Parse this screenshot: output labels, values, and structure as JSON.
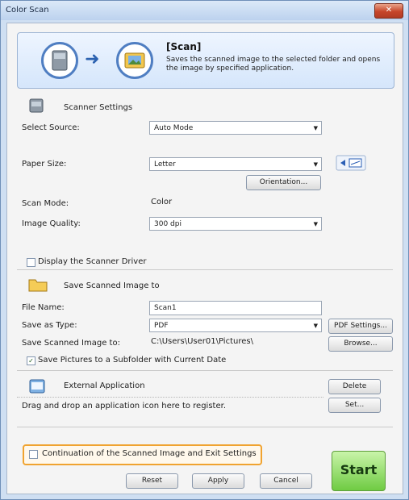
{
  "window": {
    "title": "Color Scan"
  },
  "header": {
    "title": "[Scan]",
    "description": "Saves the scanned image to the selected folder and opens the image by specified application.",
    "icons": [
      "scanner-icon",
      "arrow-right-icon",
      "picture-folder-icon"
    ]
  },
  "scanner_settings": {
    "section_label": "Scanner Settings",
    "select_source_label": "Select Source:",
    "select_source_value": "Auto Mode",
    "paper_size_label": "Paper Size:",
    "paper_size_value": "Letter",
    "orientation_label": "Orientation...",
    "scan_mode_label": "Scan Mode:",
    "scan_mode_value": "Color",
    "image_quality_label": "Image Quality:",
    "image_quality_value": "300 dpi",
    "display_driver_label": "Display the Scanner Driver"
  },
  "save": {
    "section_label": "Save Scanned Image to",
    "file_name_label": "File Name:",
    "file_name_value": "Scan1",
    "save_type_label": "Save as Type:",
    "save_type_value": "PDF",
    "pdf_settings_label": "PDF Settings...",
    "save_location_label": "Save Scanned Image to:",
    "save_location_value": "C:\\Users\\User01\\Pictures\\",
    "browse_label": "Browse...",
    "subfolder_label": "Save Pictures to a Subfolder with Current Date",
    "subfolder_checked": "✓"
  },
  "external": {
    "section_label": "External Application",
    "drag_text": "Drag and drop an application icon here to register.",
    "delete_label": "Delete",
    "set_label": "Set..."
  },
  "footer": {
    "continuation_label": "Continuation of the Scanned Image and Exit Settings",
    "reset_label": "Reset",
    "apply_label": "Apply",
    "cancel_label": "Cancel",
    "start_label": "Start"
  },
  "colors": {
    "accent": "#4f7ec2",
    "highlight": "#f0a330",
    "start": "#6fcb43"
  }
}
